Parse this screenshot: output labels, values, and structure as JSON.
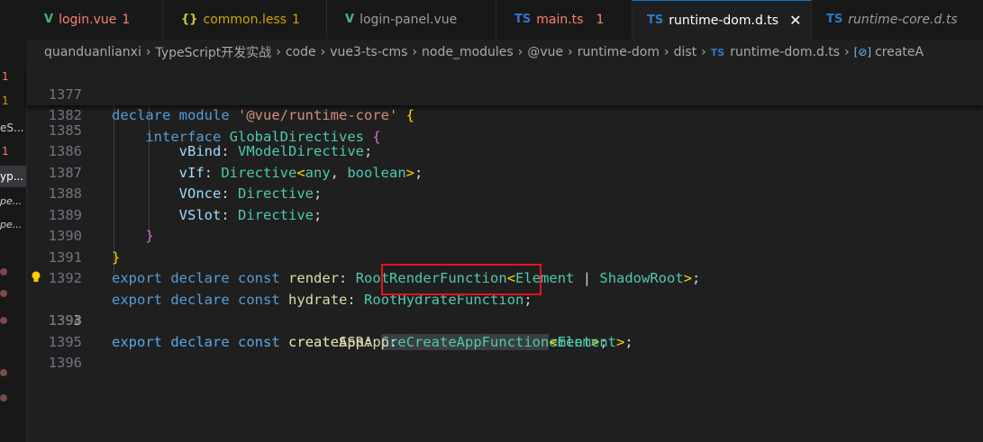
{
  "sidebar": {
    "items": [
      {
        "text": "1",
        "color": "#f88070"
      },
      {
        "text": "1",
        "color": "#cca700"
      },
      {
        "text": "eS...",
        "color": "#cccccc"
      },
      {
        "text": "1",
        "color": "#f88070"
      },
      {
        "text": "yp...",
        "color": "#ffffff"
      },
      {
        "text": "pe...",
        "color": "#cccccc"
      },
      {
        "text": "pe...",
        "color": "#cccccc"
      }
    ]
  },
  "tabs": [
    {
      "icon": "vue-icon",
      "glyph": "V",
      "name": "login.vue",
      "count": "1",
      "style": "error"
    },
    {
      "icon": "braces-icon",
      "glyph": "{}",
      "name": "common.less",
      "count": "1",
      "style": "warn"
    },
    {
      "icon": "vue-icon",
      "glyph": "V",
      "name": "login-panel.vue",
      "count": "",
      "style": "plain"
    },
    {
      "icon": "ts-icon",
      "glyph": "TS",
      "name": "main.ts",
      "count": "1",
      "style": "error"
    },
    {
      "icon": "ts-icon",
      "glyph": "TS",
      "name": "runtime-dom.d.ts",
      "count": "",
      "style": "active"
    },
    {
      "icon": "ts-icon",
      "glyph": "TS",
      "name": "runtime-core.d.ts",
      "count": "",
      "style": "preview"
    }
  ],
  "tab_close": "✕",
  "breadcrumb": [
    "quanduanlianxi",
    "TypeScript开发实战",
    "code",
    "vue3-ts-cms",
    "node_modules",
    "@vue",
    "runtime-dom",
    "dist"
  ],
  "breadcrumb_file": "runtime-dom.d.ts",
  "breadcrumb_symbol": "createA",
  "breadcrumb_ts": "TS",
  "breadcrumb_symbol_glyph": "[⊘]",
  "editor": {
    "sticky": [
      {
        "num": "1377",
        "code": "declare module '@vue/runtime-core' {"
      },
      {
        "num": "1382",
        "code": "    interface GlobalDirectives {"
      }
    ],
    "lines": [
      {
        "num": "1385",
        "code": "        vBind: VModelDirective;"
      },
      {
        "num": "1386",
        "code": "        vIf: Directive<any, boolean>;"
      },
      {
        "num": "1387",
        "code": "        VOnce: Directive;"
      },
      {
        "num": "1388",
        "code": "        VSlot: Directive;"
      },
      {
        "num": "1389",
        "code": "    }"
      },
      {
        "num": "1390",
        "code": "}"
      },
      {
        "num": "1391",
        "code": "export declare const render: RootRenderFunction<Element | ShadowRoot>;"
      },
      {
        "num": "1392",
        "code": "export declare const hydrate: RootHydrateFunction;"
      },
      {
        "num": "1393",
        "code": "export declare const createApp: CreateAppFunction<Element>;"
      },
      {
        "num": "1394",
        "code": "export declare const createSSRApp: CreateAppFunction<Element>;"
      },
      {
        "num": "1395",
        "code": ""
      },
      {
        "num": "1396",
        "code": ""
      }
    ],
    "current_line": "1393"
  }
}
